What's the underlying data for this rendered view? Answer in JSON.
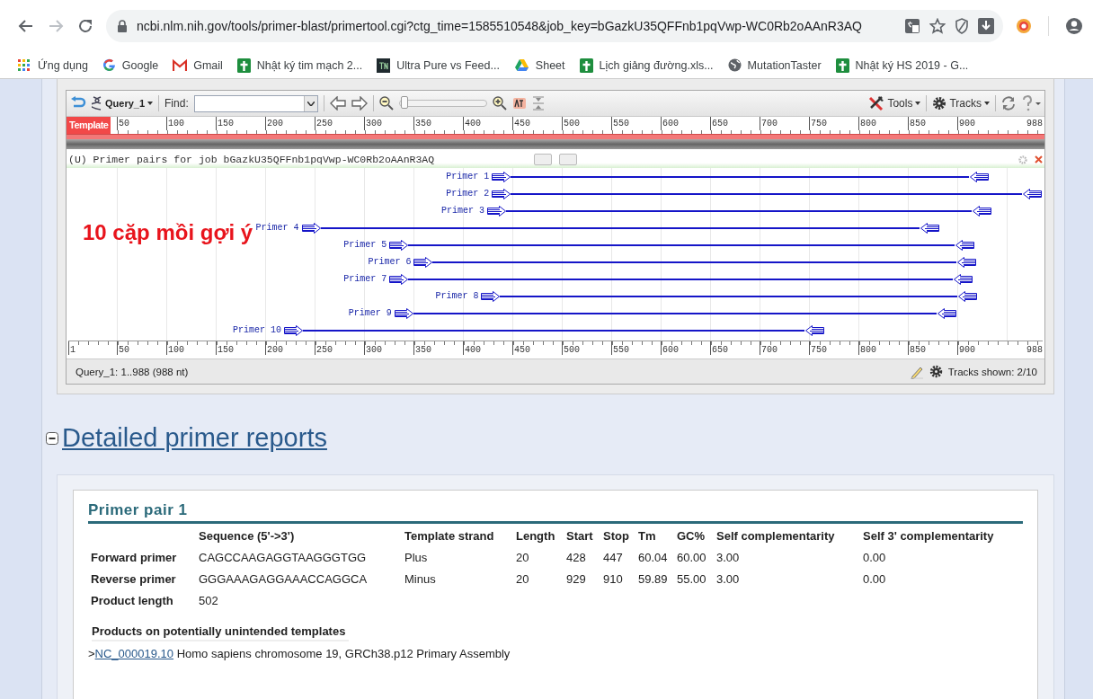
{
  "browser": {
    "url": "ncbi.nlm.nih.gov/tools/primer-blast/primertool.cgi?ctg_time=1585510548&job_key=bGazkU35QFFnb1pqVwp-WC0Rb2oAAnR3AQ"
  },
  "bookmarks": [
    {
      "label": "Ứng dụng",
      "kind": "apps"
    },
    {
      "label": "Google",
      "kind": "google"
    },
    {
      "label": "Gmail",
      "kind": "gmail"
    },
    {
      "label": "Nhật ký tim mạch 2...",
      "kind": "sheets"
    },
    {
      "label": "Ultra Pure vs Feed...",
      "kind": "tn"
    },
    {
      "label": "Sheet",
      "kind": "drive"
    },
    {
      "label": "Lịch giảng đường.xls...",
      "kind": "sheets"
    },
    {
      "label": "MutationTaster",
      "kind": "globe"
    },
    {
      "label": "Nhật ký HS 2019 - G...",
      "kind": "sheets"
    }
  ],
  "viewer": {
    "query": "Query_1",
    "find_label": "Find:",
    "zoom": {
      "level": 0.02
    },
    "tools": "Tools",
    "tracks": "Tracks",
    "ruler_label": "Template",
    "ticks": [
      "50",
      "100",
      "150",
      "200",
      "250",
      "300",
      "350",
      "400",
      "450",
      "500",
      "550",
      "600",
      "650",
      "700",
      "750",
      "800",
      "850",
      "900",
      "988"
    ],
    "track_title": "(U) Primer pairs for job bGazkU35QFFnb1pqVwp-WC0Rb2oAAnR3AQ",
    "primers": [
      {
        "label": "Primer 1",
        "forward": {
          "level": 0.434
        },
        "reverse": {
          "level": 0.943
        }
      },
      {
        "label": "Primer 2",
        "forward": {
          "level": 0.434
        },
        "reverse": {
          "level": 0.997
        }
      },
      {
        "label": "Primer 3",
        "forward": {
          "level": 0.429
        },
        "reverse": {
          "level": 0.946
        }
      },
      {
        "label": "Primer 4",
        "forward": {
          "level": 0.239
        },
        "reverse": {
          "level": 0.892
        }
      },
      {
        "label": "Primer 5",
        "forward": {
          "level": 0.329
        },
        "reverse": {
          "level": 0.928
        }
      },
      {
        "label": "Primer 6",
        "forward": {
          "level": 0.354
        },
        "reverse": {
          "level": 0.93
        }
      },
      {
        "label": "Primer 7",
        "forward": {
          "level": 0.329
        },
        "reverse": {
          "level": 0.926
        }
      },
      {
        "label": "Primer 8",
        "forward": {
          "level": 0.423
        },
        "reverse": {
          "level": 0.931
        }
      },
      {
        "label": "Primer 9",
        "forward": {
          "level": 0.334
        },
        "reverse": {
          "level": 0.91
        }
      },
      {
        "label": "Primer 10",
        "forward": {
          "level": 0.221
        },
        "reverse": {
          "level": 0.774
        }
      }
    ],
    "bottom_ticks": [
      "1",
      "50",
      "100",
      "150",
      "200",
      "250",
      "300",
      "350",
      "400",
      "450",
      "500",
      "550",
      "600",
      "650",
      "700",
      "750",
      "800",
      "850",
      "900",
      "988"
    ],
    "status": "Query_1: 1..988 (988 nt)",
    "tracks_shown": "Tracks shown: 2/10"
  },
  "annotation": "10 cặp mồi gợi ý",
  "report": {
    "heading": "Detailed primer reports",
    "pair_title": "Primer pair 1",
    "columns": [
      "",
      "Sequence (5'->3')",
      "Template strand",
      "Length",
      "Start",
      "Stop",
      "Tm",
      "GC%",
      "Self complementarity",
      "Self 3' complementarity"
    ],
    "rows": [
      [
        "Forward primer",
        "CAGCCAAGAGGTAAGGGTGG",
        "Plus",
        "20",
        "428",
        "447",
        "60.04",
        "60.00",
        "3.00",
        "0.00"
      ],
      [
        "Reverse primer",
        "GGGAAAGAGGAAACCAGGCA",
        "Minus",
        "20",
        "929",
        "910",
        "59.89",
        "55.00",
        "3.00",
        "0.00"
      ],
      [
        "Product length",
        "502"
      ]
    ],
    "unintended": {
      "title": "Products on potentially unintended templates",
      "prefix": ">",
      "link": "NC_000019.10",
      "text": "Homo sapiens chromosome 19, GRCh38.p12 Primary Assembly"
    }
  }
}
